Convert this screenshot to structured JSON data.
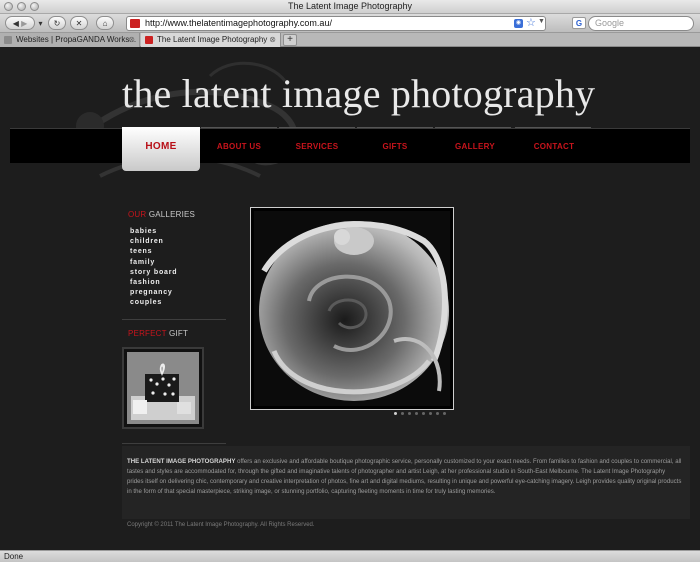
{
  "browser": {
    "window_title": "The Latent Image Photography",
    "url": "http://www.thelatentimagephotography.com.au/",
    "search_placeholder": "Google",
    "tabs": [
      {
        "label": "Websites | PropaGANDA Works..."
      },
      {
        "label": "The Latent Image Photography"
      }
    ],
    "new_tab_label": "+",
    "status": "Done"
  },
  "site": {
    "title": "the latent image photography",
    "nav": [
      {
        "label": "HOME"
      },
      {
        "label": "ABOUT US"
      },
      {
        "label": "SERVICES"
      },
      {
        "label": "GIFTS"
      },
      {
        "label": "GALLERY"
      },
      {
        "label": "CONTACT"
      }
    ],
    "active_nav": "HOME",
    "galleries_heading": {
      "accent": "OUR",
      "rest": " GALLERIES"
    },
    "galleries": [
      "babies",
      "children",
      "teens",
      "family",
      "story board",
      "fashion",
      "pregnancy",
      "couples"
    ],
    "gift_heading": {
      "accent": "PERFECT",
      "rest": " GIFT"
    },
    "slideshow": {
      "total": 8,
      "active": 1
    },
    "about": {
      "lead": "THE LATENT IMAGE PHOTOGRAPHY",
      "body": " offers an exclusive and affordable boutique photographic service, personally customized to your exact needs. From families to fashion and couples to commercial, all tastes and styles are accommodated for, through the gifted and imaginative talents of photographer and artist Leigh, at her professional studio in South-East Melbourne. The Latent Image Photography prides itself on delivering chic, contemporary and creative interpretation of photos, fine art and digital mediums, resulting in unique and powerful eye-catching imagery. Leigh provides quality original products in the form of that special masterpiece, striking image, or stunning portfolio, capturing fleeting moments in time for truly lasting memories."
    },
    "copyright": "Copyright © 2011 The Latent Image Photography. All Rights Reserved."
  },
  "colors": {
    "accent_red": "#c8141c",
    "page_bg": "#1d1d1d",
    "nav_bg": "#000000"
  }
}
